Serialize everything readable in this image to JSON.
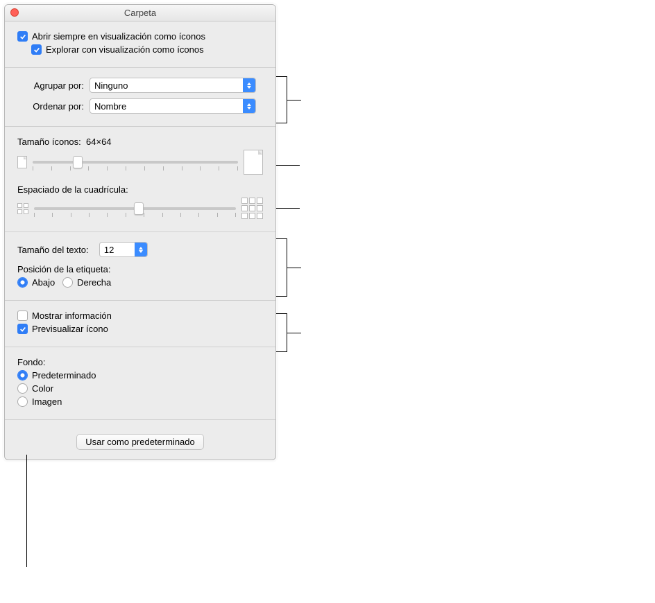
{
  "title": "Carpeta",
  "section1": {
    "open_always": {
      "checked": true,
      "label": "Abrir siempre en visualización como íconos"
    },
    "browse": {
      "checked": true,
      "label": "Explorar con visualización como íconos"
    }
  },
  "section2": {
    "group_by": {
      "label": "Agrupar por:",
      "value": "Ninguno"
    },
    "sort_by": {
      "label": "Ordenar por:",
      "value": "Nombre"
    }
  },
  "section3": {
    "icon_size_label": "Tamaño íconos:",
    "icon_size_value": "64×64",
    "icon_size_percent": 22,
    "grid_spacing_label": "Espaciado de la cuadrícula:",
    "grid_spacing_percent": 52
  },
  "section4": {
    "text_size_label": "Tamaño del texto:",
    "text_size_value": "12",
    "label_position_label": "Posición de la etiqueta:",
    "positions": {
      "bottom": {
        "label": "Abajo",
        "checked": true
      },
      "right": {
        "label": "Derecha",
        "checked": false
      }
    }
  },
  "section5": {
    "show_info": {
      "label": "Mostrar información",
      "checked": false
    },
    "preview": {
      "label": "Previsualizar ícono",
      "checked": true
    }
  },
  "section6": {
    "background_label": "Fondo:",
    "options": {
      "default": {
        "label": "Predeterminado",
        "checked": true
      },
      "color": {
        "label": "Color",
        "checked": false
      },
      "image": {
        "label": "Imagen",
        "checked": false
      }
    }
  },
  "footer": {
    "use_default": "Usar como predeterminado"
  }
}
